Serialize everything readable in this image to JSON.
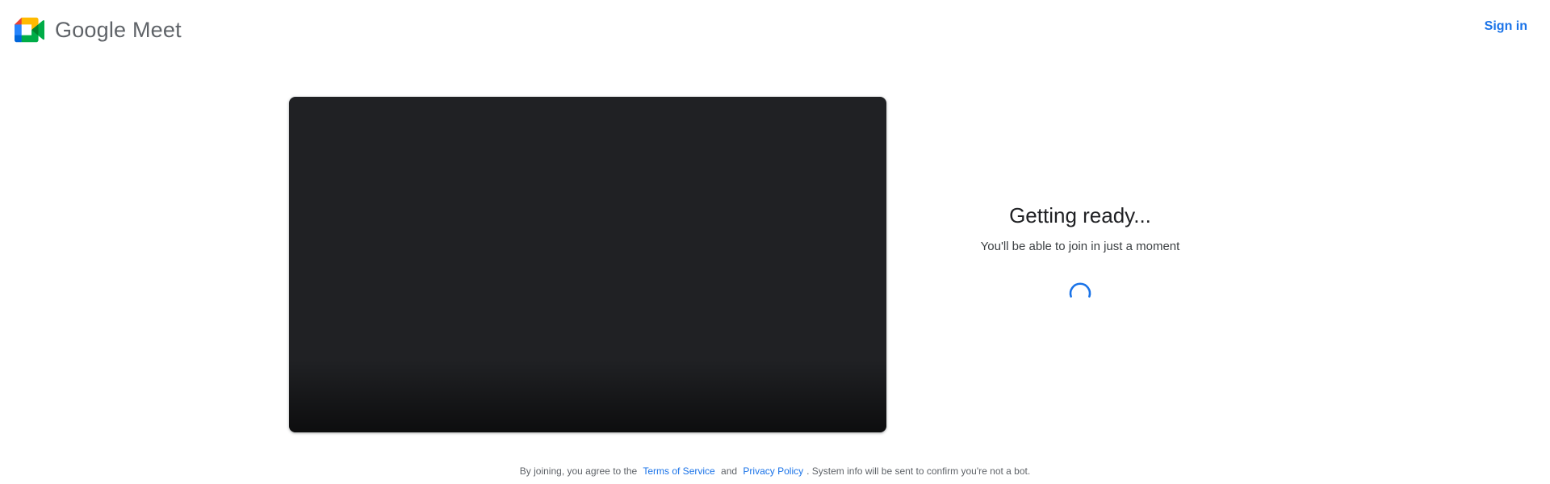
{
  "header": {
    "brand_name": "Google Meet",
    "sign_in_label": "Sign in"
  },
  "colors": {
    "accent": "#1a73e8",
    "preview_bg": "#202124",
    "logo_blue": "#4285f4",
    "logo_green": "#34a853",
    "logo_yellow": "#fbbc04",
    "logo_red": "#ea4335"
  },
  "status": {
    "title": "Getting ready...",
    "subtitle": "You'll be able to join in just a moment"
  },
  "footer": {
    "prefix": "By joining, you agree to the",
    "terms_label": "Terms of Service",
    "and": "and",
    "privacy_label": "Privacy Policy",
    "suffix": ". System info will be sent to confirm you're not a bot."
  },
  "icons": {
    "logo": "google-meet-logo",
    "spinner": "loading-spinner"
  }
}
